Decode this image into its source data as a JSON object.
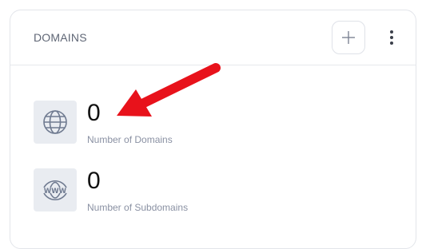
{
  "card": {
    "title": "DOMAINS",
    "add_button_icon": "plus-icon",
    "more_button_icon": "vertical-dots-icon"
  },
  "stats": [
    {
      "icon": "globe-icon",
      "value": "0",
      "label": "Number of Domains"
    },
    {
      "icon": "www-icon",
      "value": "0",
      "label": "Number of Subdomains"
    }
  ],
  "www_icon_text": "WWW",
  "colors": {
    "accent_arrow": "#e8121b",
    "icon_box": "#e9ecf1",
    "icon_stroke": "#6f7a90",
    "label": "#8a91a3",
    "title": "#5f6675"
  }
}
